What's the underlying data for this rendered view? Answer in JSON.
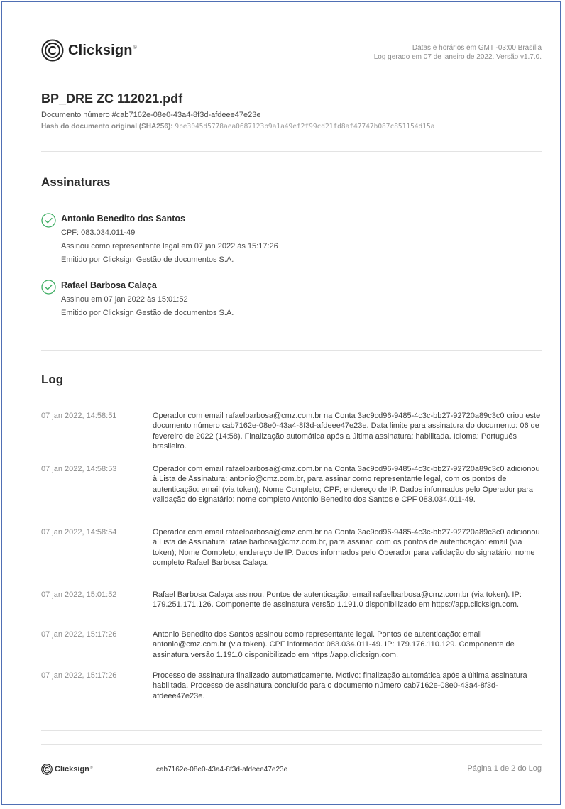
{
  "header": {
    "logo_text": "Clicksign",
    "logo_reg": "®",
    "timezone_note": "Datas e horários em GMT -03:00 Brasília",
    "log_generated": "Log gerado em 07 de janeiro de 2022. Versão v1.7.0."
  },
  "document": {
    "title": "BP_DRE ZC 112021.pdf",
    "number_line": "Documento número #cab7162e-08e0-43a4-8f3d-afdeee47e23e",
    "hash_label": "Hash do documento original (SHA256):",
    "hash_value": "9be3045d5778aea0687123b9a1a49ef2f99cd21fd8af47747b087c851154d15a"
  },
  "signatures": {
    "title": "Assinaturas",
    "signers": [
      {
        "name": "Antonio Benedito dos Santos",
        "lines": [
          "CPF: 083.034.011-49",
          "Assinou como representante legal em 07 jan 2022 às 15:17:26",
          "Emitido por Clicksign Gestão de documentos S.A."
        ]
      },
      {
        "name": "Rafael Barbosa Calaça",
        "lines": [
          "Assinou em 07 jan 2022 às 15:01:52",
          "Emitido por Clicksign Gestão de documentos S.A."
        ]
      }
    ]
  },
  "log": {
    "title": "Log",
    "entries": [
      {
        "timestamp": "07 jan 2022, 14:58:51",
        "message": "Operador com email rafaelbarbosa@cmz.com.br na Conta 3ac9cd96-9485-4c3c-bb27-92720a89c3c0 criou este documento número cab7162e-08e0-43a4-8f3d-afdeee47e23e. Data limite para assinatura do documento: 06 de fevereiro de 2022 (14:58). Finalização automática após a última assinatura: habilitada. Idioma: Português brasileiro."
      },
      {
        "timestamp": "07 jan 2022, 14:58:53",
        "message": "Operador com email rafaelbarbosa@cmz.com.br na Conta 3ac9cd96-9485-4c3c-bb27-92720a89c3c0 adicionou à Lista de Assinatura: antonio@cmz.com.br, para assinar como representante legal, com os pontos de autenticação: email (via token); Nome Completo; CPF; endereço de IP. Dados informados pelo Operador para validação do signatário: nome completo Antonio Benedito dos Santos e CPF 083.034.011-49."
      },
      {
        "timestamp": "07 jan 2022, 14:58:54",
        "message": "Operador com email rafaelbarbosa@cmz.com.br na Conta 3ac9cd96-9485-4c3c-bb27-92720a89c3c0 adicionou à Lista de Assinatura: rafaelbarbosa@cmz.com.br, para assinar, com os pontos de autenticação: email (via token); Nome Completo; endereço de IP. Dados informados pelo Operador para validação do signatário: nome completo Rafael Barbosa Calaça."
      },
      {
        "timestamp": "07 jan 2022, 15:01:52",
        "message": "Rafael Barbosa Calaça assinou. Pontos de autenticação: email rafaelbarbosa@cmz.com.br (via token). IP: 179.251.171.126. Componente de assinatura versão 1.191.0 disponibilizado em https://app.clicksign.com."
      },
      {
        "timestamp": "07 jan 2022, 15:17:26",
        "message": "Antonio Benedito dos Santos assinou como representante legal. Pontos de autenticação: email antonio@cmz.com.br (via token). CPF informado: 083.034.011-49. IP: 179.176.110.129. Componente de assinatura versão 1.191.0 disponibilizado em https://app.clicksign.com."
      },
      {
        "timestamp": "07 jan 2022, 15:17:26",
        "message": "Processo de assinatura finalizado automaticamente. Motivo: finalização automática após a última assinatura habilitada. Processo de assinatura concluído para o documento número cab7162e-08e0-43a4-8f3d-afdeee47e23e."
      }
    ]
  },
  "footer": {
    "logo_text": "Clicksign",
    "logo_reg": "®",
    "document_id": "cab7162e-08e0-43a4-8f3d-afdeee47e23e",
    "page_label": "Página 1 de 2 do Log"
  },
  "colors": {
    "frame": "#4f6fb4",
    "check_green": "#3fae63",
    "divider": "#e3e3e3"
  },
  "icons": [
    "clicksign-logo-icon",
    "check-circle-icon"
  ]
}
